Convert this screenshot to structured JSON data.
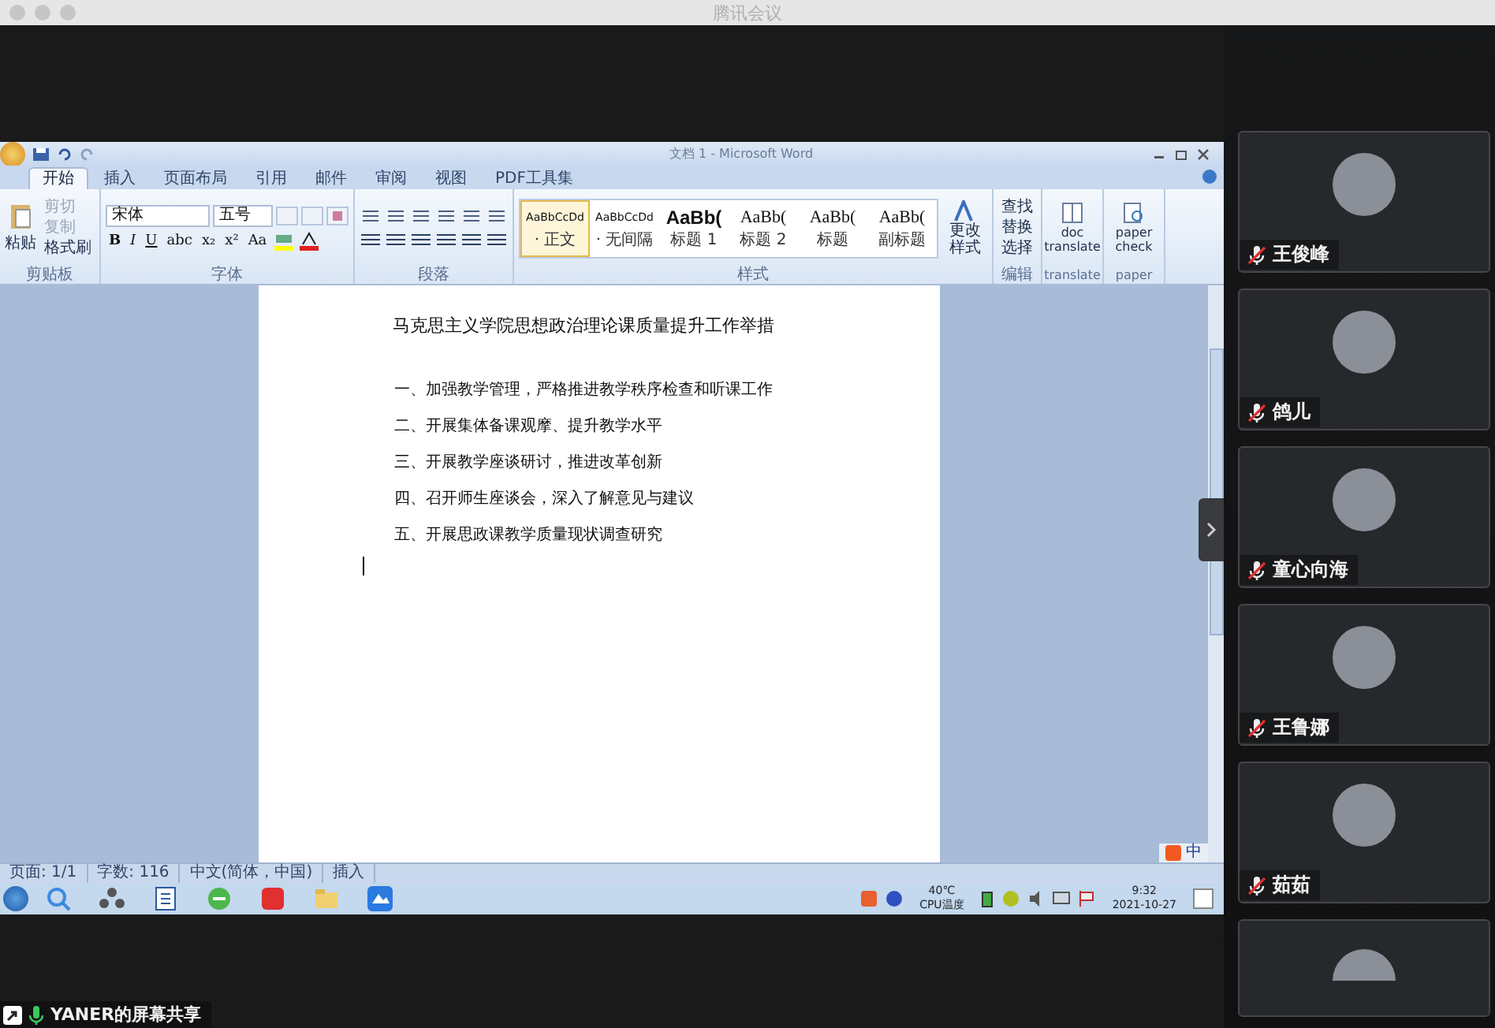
{
  "app": {
    "title": "腾讯会议"
  },
  "word": {
    "title": "文档 1 - Microsoft Word",
    "tabs": [
      {
        "label": "开始",
        "selected": true
      },
      {
        "label": "插入",
        "selected": false
      },
      {
        "label": "页面布局",
        "selected": false
      },
      {
        "label": "引用",
        "selected": false
      },
      {
        "label": "邮件",
        "selected": false
      },
      {
        "label": "审阅",
        "selected": false
      },
      {
        "label": "视图",
        "selected": false
      },
      {
        "label": "PDF工具集",
        "selected": false
      }
    ],
    "clipboard": {
      "paste": "粘贴",
      "items": [
        "剪切",
        "复制",
        "格式刷"
      ],
      "label": "剪贴板"
    },
    "font": {
      "name": "宋体",
      "size": "五号",
      "buttons": [
        "B",
        "I",
        "U",
        "abc",
        "x₂",
        "x²",
        "Aa"
      ],
      "label": "字体"
    },
    "paragraph": {
      "label": "段落"
    },
    "styles": {
      "items": [
        {
          "preview": "AaBbCcDd",
          "name": "· 正文",
          "kind": "body",
          "selected": true
        },
        {
          "preview": "AaBbCcDd",
          "name": "· 无间隔",
          "kind": "body",
          "selected": false
        },
        {
          "preview": "AaBb(",
          "name": "标题 1",
          "kind": "heading",
          "selected": false
        },
        {
          "preview": "AaBb(",
          "name": "标题 2",
          "kind": "serif",
          "selected": false
        },
        {
          "preview": "AaBb(",
          "name": "标题",
          "kind": "serif",
          "selected": false
        },
        {
          "preview": "AaBb(",
          "name": "副标题",
          "kind": "serif",
          "selected": false
        }
      ],
      "change": "更改样式",
      "label": "样式"
    },
    "editing": {
      "items": [
        "查找",
        "替换",
        "选择"
      ],
      "label": "编辑"
    },
    "translate": {
      "button": "doc translate",
      "label": "translate"
    },
    "paper": {
      "button": "paper check",
      "label": "paper"
    },
    "document": {
      "title": "马克思主义学院思想政治理论课质量提升工作举措",
      "lines": [
        "一、加强教学管理，严格推进教学秩序检查和听课工作",
        "二、开展集体备课观摩、提升教学水平",
        "三、开展教学座谈研讨，推进改革创新",
        "四、召开师生座谈会，深入了解意见与建议",
        "五、开展思政课教学质量现状调查研究"
      ]
    },
    "ime": "中",
    "status_bar": [
      "页面: 1/1",
      "字数: 116",
      "中文(简体，中国)",
      "插入"
    ]
  },
  "taskbar": {
    "temperature": "40℃",
    "temperature_label": "CPU温度",
    "time": "9:32",
    "date": "2021-10-27"
  },
  "share_label": "YANER的屏幕共享",
  "participants": [
    {
      "name": "王俊峰",
      "muted": true
    },
    {
      "name": "鸽儿",
      "muted": true
    },
    {
      "name": "童心向海",
      "muted": true
    },
    {
      "name": "王鲁娜",
      "muted": true
    },
    {
      "name": "茹茹",
      "muted": true
    }
  ]
}
